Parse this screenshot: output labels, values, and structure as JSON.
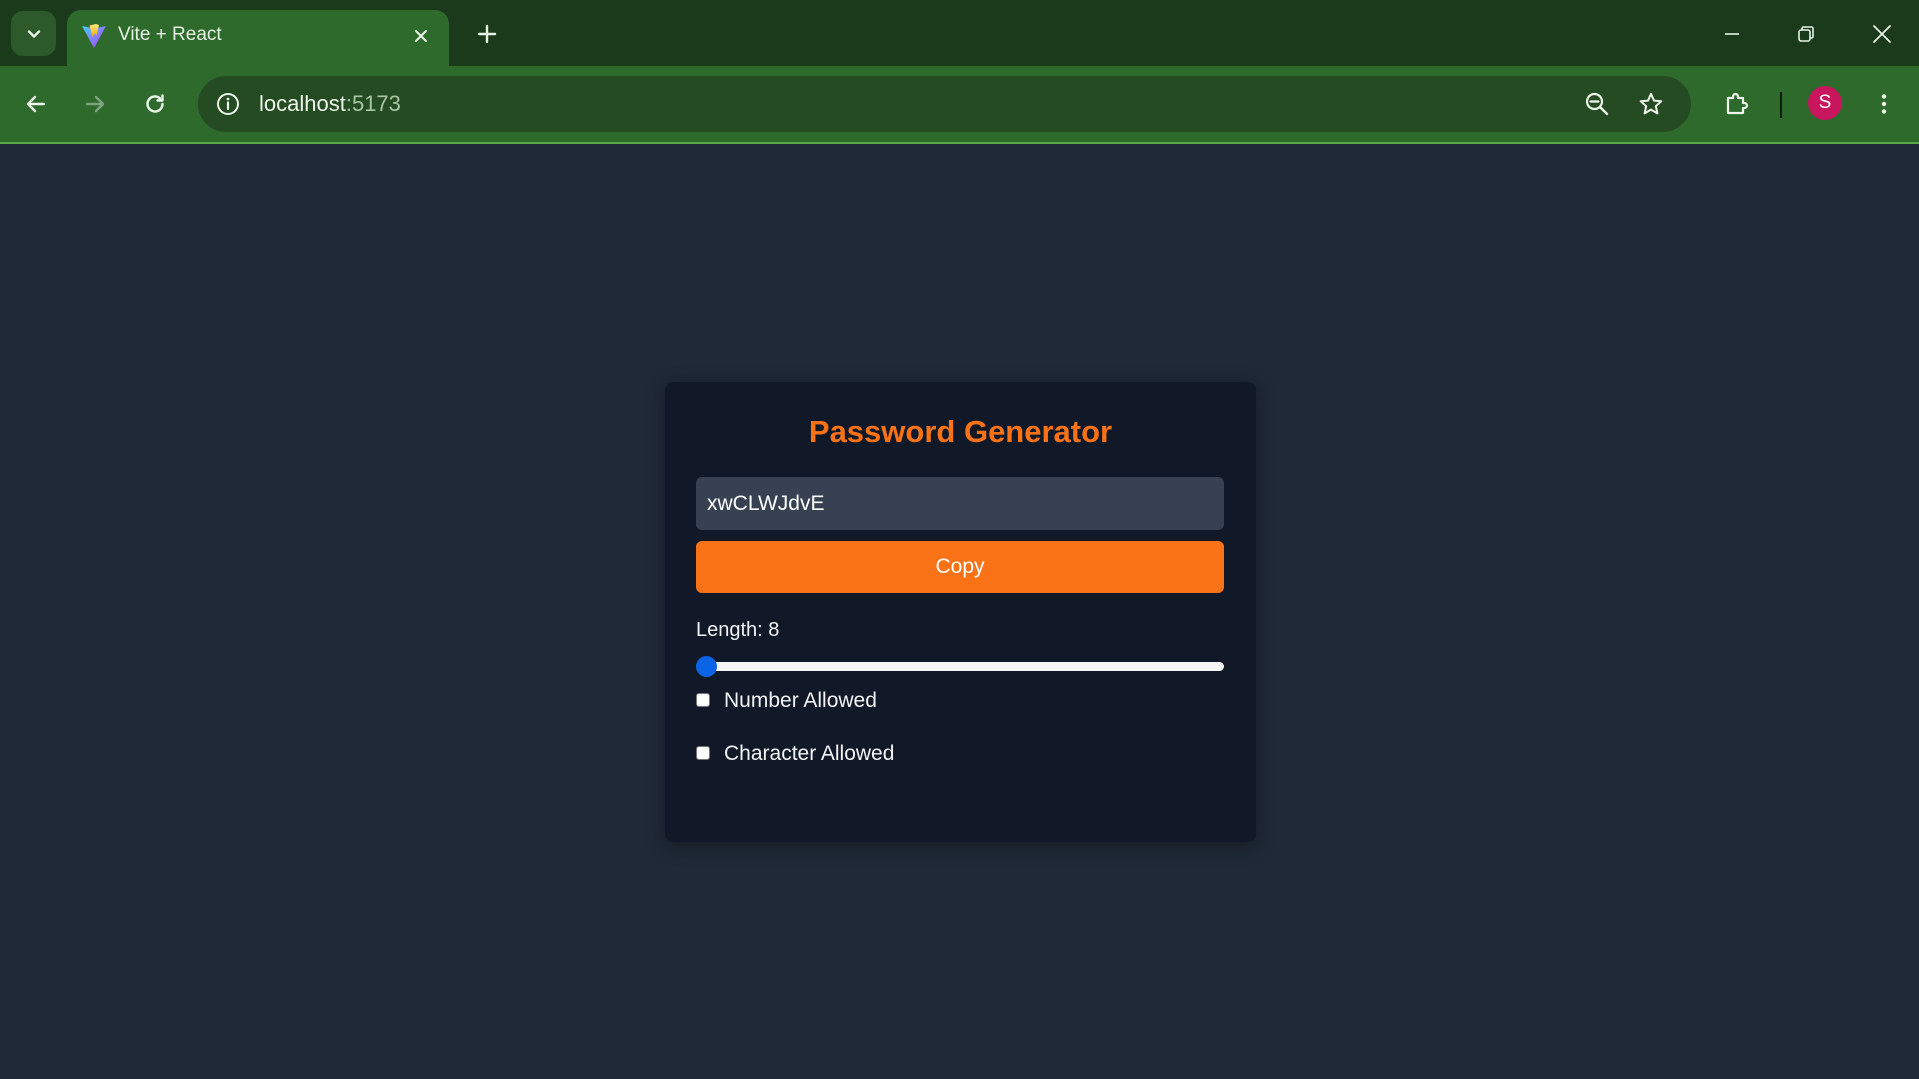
{
  "browser": {
    "tab": {
      "title": "Vite + React"
    },
    "address": {
      "host": "localhost",
      "port": ":5173"
    },
    "profile_initial": "S",
    "colors": {
      "frame": "#1b3a1b",
      "toolbar": "#2e6a2c",
      "omnibox": "#244b22",
      "avatar": "#c7155e"
    },
    "icons": {
      "tab_search": "chevron-down-icon",
      "favicon": "vite-logo-icon",
      "tab_close": "close-icon",
      "new_tab": "plus-icon",
      "minimize": "minimize-icon",
      "restore": "restore-icon",
      "close_window": "close-icon",
      "back": "back-arrow-icon",
      "forward": "forward-arrow-icon",
      "reload": "reload-icon",
      "site_info": "info-icon",
      "zoom": "zoom-out-icon",
      "bookmark": "star-icon",
      "extensions": "puzzle-icon",
      "menu": "kebab-menu-icon"
    }
  },
  "app": {
    "title": "Password Generator",
    "password": "xwCLWJdvE",
    "copy_label": "Copy",
    "length_label": "Length: 8",
    "length": {
      "value": 8,
      "min": 8,
      "max": 100
    },
    "options": [
      {
        "label": "Number Allowed",
        "checked": false
      },
      {
        "label": "Character Allowed",
        "checked": false
      }
    ],
    "colors": {
      "background": "#1f2937",
      "card": "#111827",
      "accent": "#f97316",
      "input": "#374151",
      "slider": "#0b63e6"
    }
  }
}
